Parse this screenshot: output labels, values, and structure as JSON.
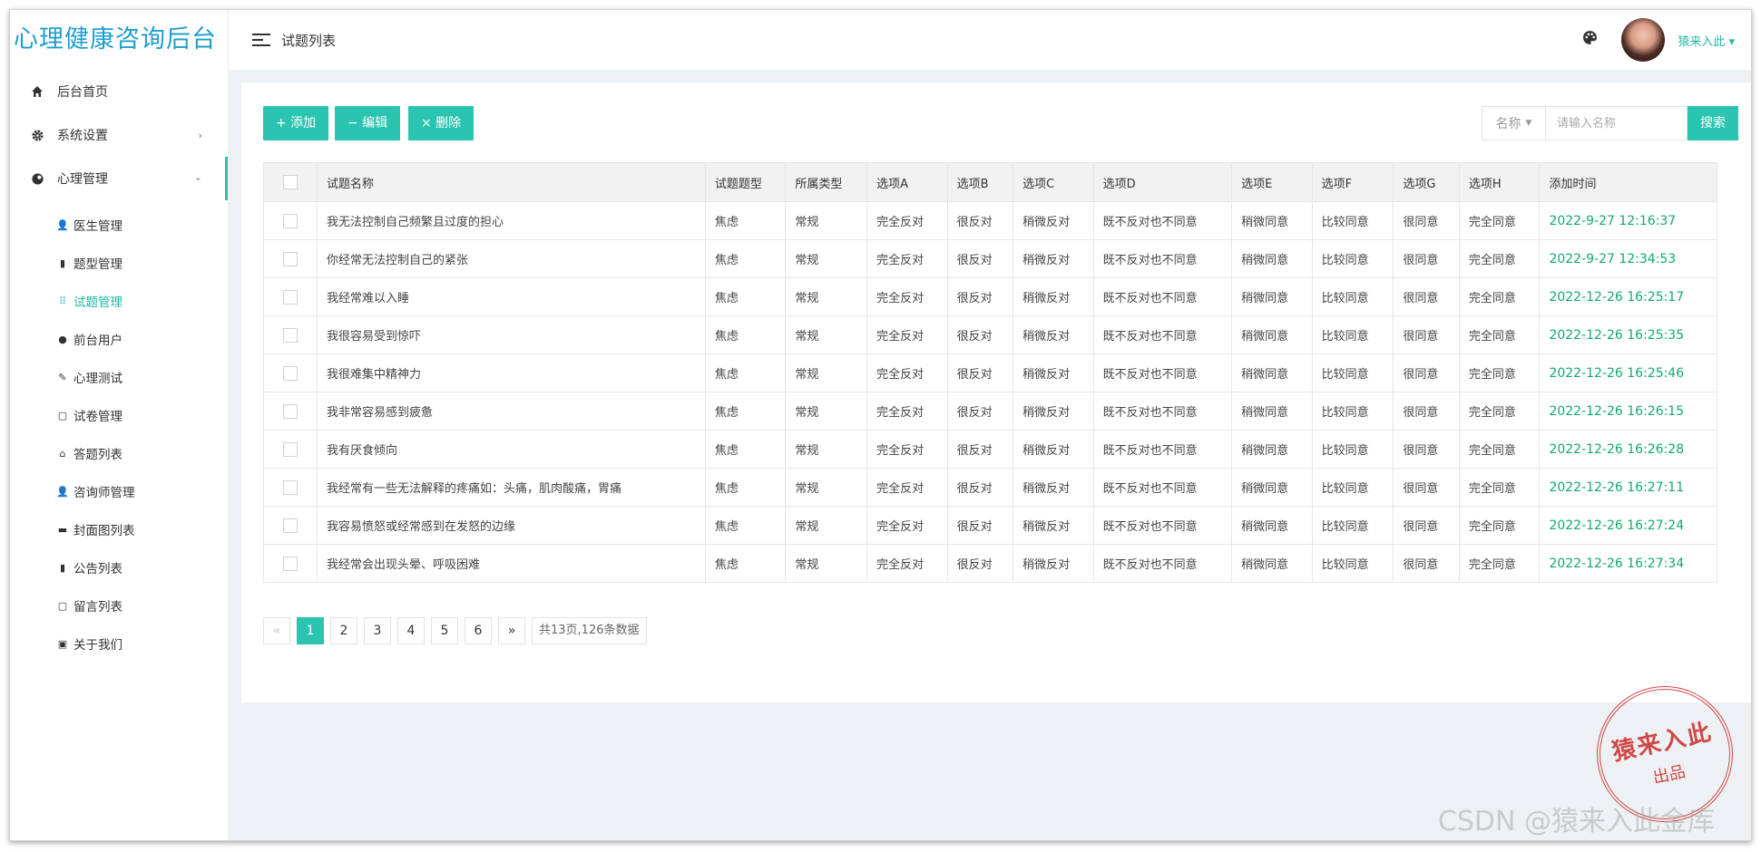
{
  "app": {
    "title": "心理健康咨询后台"
  },
  "header": {
    "page_title": "试题列表",
    "username": "猿来入此"
  },
  "sidebar": {
    "items": [
      {
        "label": "后台首页",
        "icon": "home-icon"
      },
      {
        "label": "系统设置",
        "icon": "gear-icon",
        "arrow": "›"
      },
      {
        "label": "心理管理",
        "icon": "brain-icon",
        "arrow": "‹"
      }
    ],
    "subitems": [
      {
        "label": "医生管理",
        "icon": "user-icon",
        "glyph": "👤"
      },
      {
        "label": "题型管理",
        "icon": "book-icon",
        "glyph": "▮"
      },
      {
        "label": "试题管理",
        "icon": "grid-icon",
        "glyph": "⠿"
      },
      {
        "label": "前台用户",
        "icon": "user-circle-icon",
        "glyph": "●"
      },
      {
        "label": "心理测试",
        "icon": "pencil-icon",
        "glyph": "✎"
      },
      {
        "label": "试卷管理",
        "icon": "clipboard-icon",
        "glyph": "▢"
      },
      {
        "label": "答题列表",
        "icon": "tent-icon",
        "glyph": "⌂"
      },
      {
        "label": "咨询师管理",
        "icon": "user-icon",
        "glyph": "👤"
      },
      {
        "label": "封面图列表",
        "icon": "image-icon",
        "glyph": "▬"
      },
      {
        "label": "公告列表",
        "icon": "book-icon",
        "glyph": "▮"
      },
      {
        "label": "留言列表",
        "icon": "window-icon",
        "glyph": "▢"
      },
      {
        "label": "关于我们",
        "icon": "id-card-icon",
        "glyph": "▣"
      }
    ]
  },
  "toolbar": {
    "add_label": "+ 添加",
    "edit_label": "− 编辑",
    "delete_label": "× 删除"
  },
  "search": {
    "select_value": "名称",
    "placeholder": "请输入名称",
    "button_label": "搜索"
  },
  "table": {
    "headers": [
      "试题名称",
      "试题题型",
      "所属类型",
      "选项A",
      "选项B",
      "选项C",
      "选项D",
      "选项E",
      "选项F",
      "选项G",
      "选项H",
      "添加时间"
    ],
    "rows": [
      [
        "我无法控制自己频繁且过度的担心",
        "焦虑",
        "常规",
        "完全反对",
        "很反对",
        "稍微反对",
        "既不反对也不同意",
        "稍微同意",
        "比较同意",
        "很同意",
        "完全同意",
        "2022-9-27 12:16:37"
      ],
      [
        "你经常无法控制自己的紧张",
        "焦虑",
        "常规",
        "完全反对",
        "很反对",
        "稍微反对",
        "既不反对也不同意",
        "稍微同意",
        "比较同意",
        "很同意",
        "完全同意",
        "2022-9-27 12:34:53"
      ],
      [
        "我经常难以入睡",
        "焦虑",
        "常规",
        "完全反对",
        "很反对",
        "稍微反对",
        "既不反对也不同意",
        "稍微同意",
        "比较同意",
        "很同意",
        "完全同意",
        "2022-12-26 16:25:17"
      ],
      [
        "我很容易受到惊吓",
        "焦虑",
        "常规",
        "完全反对",
        "很反对",
        "稍微反对",
        "既不反对也不同意",
        "稍微同意",
        "比较同意",
        "很同意",
        "完全同意",
        "2022-12-26 16:25:35"
      ],
      [
        "我很难集中精神力",
        "焦虑",
        "常规",
        "完全反对",
        "很反对",
        "稍微反对",
        "既不反对也不同意",
        "稍微同意",
        "比较同意",
        "很同意",
        "完全同意",
        "2022-12-26 16:25:46"
      ],
      [
        "我非常容易感到疲惫",
        "焦虑",
        "常规",
        "完全反对",
        "很反对",
        "稍微反对",
        "既不反对也不同意",
        "稍微同意",
        "比较同意",
        "很同意",
        "完全同意",
        "2022-12-26 16:26:15"
      ],
      [
        "我有厌食倾向",
        "焦虑",
        "常规",
        "完全反对",
        "很反对",
        "稍微反对",
        "既不反对也不同意",
        "稍微同意",
        "比较同意",
        "很同意",
        "完全同意",
        "2022-12-26 16:26:28"
      ],
      [
        "我经常有一些无法解释的疼痛如：头痛，肌肉酸痛，胃痛",
        "焦虑",
        "常规",
        "完全反对",
        "很反对",
        "稍微反对",
        "既不反对也不同意",
        "稍微同意",
        "比较同意",
        "很同意",
        "完全同意",
        "2022-12-26 16:27:11"
      ],
      [
        "我容易愤怒或经常感到在发怒的边缘",
        "焦虑",
        "常规",
        "完全反对",
        "很反对",
        "稍微反对",
        "既不反对也不同意",
        "稍微同意",
        "比较同意",
        "很同意",
        "完全同意",
        "2022-12-26 16:27:24"
      ],
      [
        "我经常会出现头晕、呼吸困难",
        "焦虑",
        "常规",
        "完全反对",
        "很反对",
        "稍微反对",
        "既不反对也不同意",
        "稍微同意",
        "比较同意",
        "很同意",
        "完全同意",
        "2022-12-26 16:27:34"
      ]
    ]
  },
  "pagination": {
    "prev": "«",
    "next": "»",
    "pages": [
      "1",
      "2",
      "3",
      "4",
      "5",
      "6"
    ],
    "current": "1",
    "info": "共13页,126条数据"
  },
  "seal": {
    "line1": "猿来入此",
    "line2": "出品"
  },
  "watermark": "CSDN @猿来入此金库",
  "colors": {
    "accent": "#2bc4b0",
    "logo": "#1e9fcf",
    "time": "#14a86d",
    "seal": "#cc2a2a"
  }
}
